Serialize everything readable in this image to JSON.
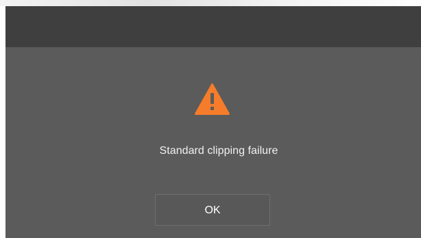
{
  "dialog": {
    "icon": "warning-icon",
    "message": "Standard clipping failure",
    "ok_label": "OK"
  },
  "colors": {
    "dialog_background": "#5b5b5b",
    "title_bar": "#3f3f3f",
    "warning": "#f57c2a",
    "text": "#f1f1f1",
    "button_border": "#6f6f6f"
  }
}
